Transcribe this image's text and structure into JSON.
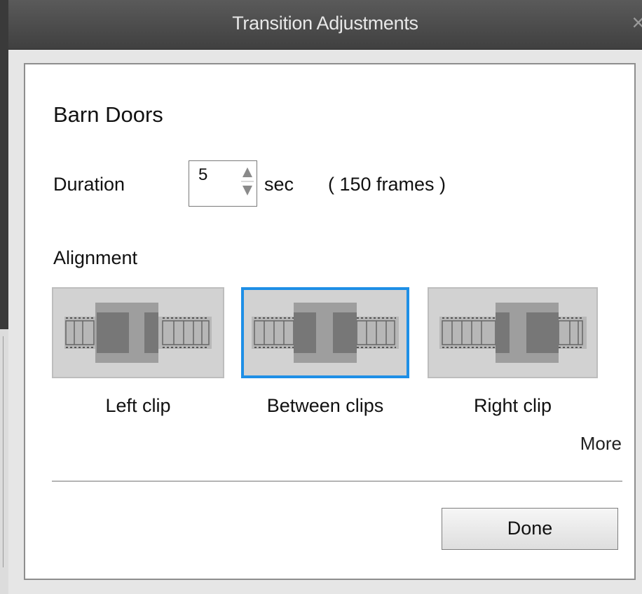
{
  "window": {
    "title": "Transition Adjustments",
    "close_icon": "close-icon"
  },
  "transition": {
    "name": "Barn Doors"
  },
  "duration": {
    "label": "Duration",
    "value": "5",
    "unit": "sec",
    "frames": "( 150 frames )"
  },
  "alignment": {
    "label": "Alignment",
    "options": [
      {
        "label": "Left clip",
        "icon": "align-left-clip-icon",
        "selected": false
      },
      {
        "label": "Between clips",
        "icon": "align-between-clips-icon",
        "selected": true
      },
      {
        "label": "Right clip",
        "icon": "align-right-clip-icon",
        "selected": false
      }
    ],
    "more_label": "More"
  },
  "actions": {
    "done_label": "Done"
  },
  "colors": {
    "selection": "#1e8fe6",
    "titlebar": "#4a4a4a"
  }
}
